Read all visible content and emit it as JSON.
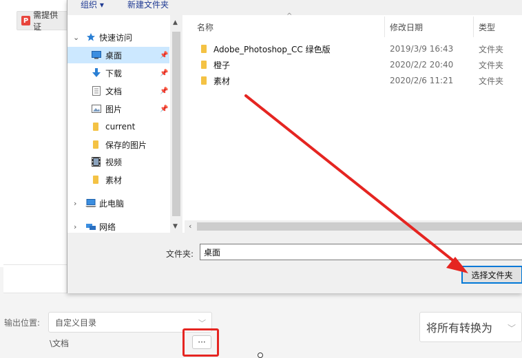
{
  "background_app": {
    "tab_icon": "P",
    "tab_label": "需提供证",
    "output_label": "输出位置:",
    "output_select_value": "自定义目录",
    "output_path": "\\文档",
    "browse_button_label": "···",
    "convert_select_value": "将所有转换为"
  },
  "dialog": {
    "toolbar": {
      "organize_label": "组织 ▾",
      "new_folder_label": "新建文件夹"
    },
    "nav": {
      "quick_access_label": "快速访问",
      "items": [
        {
          "label": "桌面",
          "icon": "desktop-icon",
          "pinned": true,
          "selected": true
        },
        {
          "label": "下载",
          "icon": "download-icon",
          "pinned": true
        },
        {
          "label": "文档",
          "icon": "document-icon",
          "pinned": true
        },
        {
          "label": "图片",
          "icon": "picture-icon",
          "pinned": true
        },
        {
          "label": "current",
          "icon": "folder-icon"
        },
        {
          "label": "保存的图片",
          "icon": "folder-icon"
        },
        {
          "label": "视频",
          "icon": "video-icon"
        },
        {
          "label": "素材",
          "icon": "folder-icon"
        }
      ],
      "this_pc_label": "此电脑",
      "network_label": "网络"
    },
    "columns": {
      "name": "名称",
      "date": "修改日期",
      "type": "类型"
    },
    "files": [
      {
        "name": "Adobe_Photoshop_CC 绿色版",
        "date": "2019/3/9 16:43",
        "type": "文件夹"
      },
      {
        "name": "橙子",
        "date": "2020/2/2 20:40",
        "type": "文件夹"
      },
      {
        "name": "素材",
        "date": "2020/2/6 11:21",
        "type": "文件夹"
      }
    ],
    "footer": {
      "folder_label": "文件夹:",
      "folder_value": "桌面",
      "select_button_label": "选择文件夹"
    }
  },
  "colors": {
    "selection": "#cce8ff",
    "folder": "#f4c244",
    "annotation_red": "#e52521",
    "default_button_border": "#0078d7"
  }
}
